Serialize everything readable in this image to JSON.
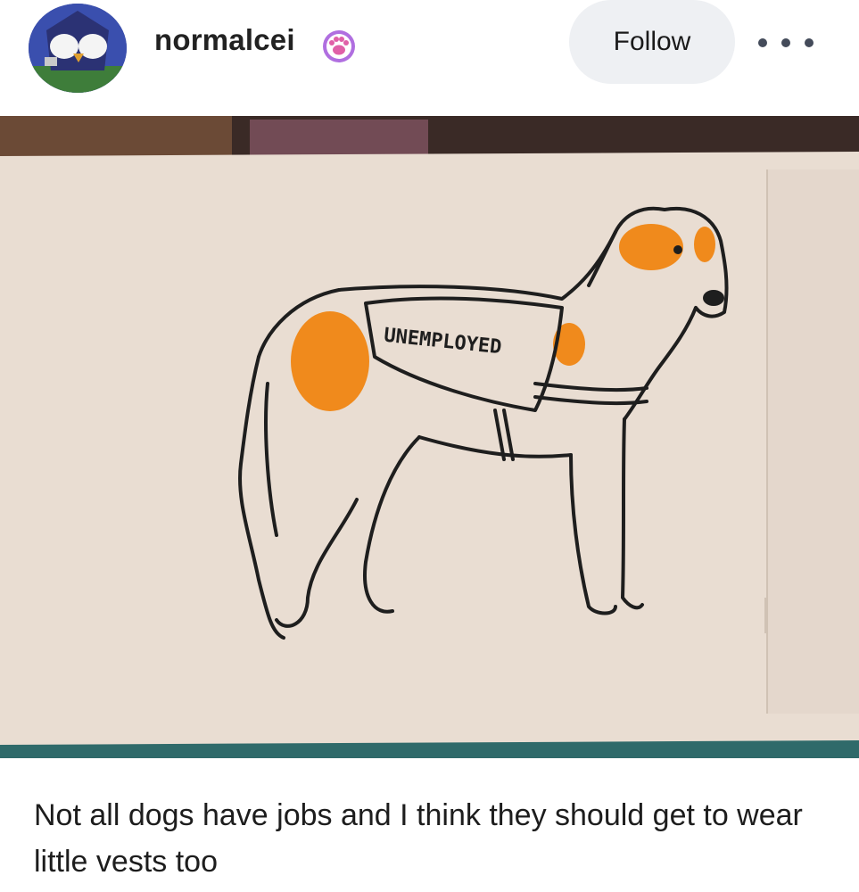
{
  "post": {
    "author": {
      "username": "normalcei",
      "avatar_icon": "avatar-penguin-icon",
      "badge_icon": "paw-badge-icon",
      "badge_color": "#b06fe0"
    },
    "actions": {
      "follow_label": "Follow",
      "more_icon": "ellipsis-icon"
    },
    "image": {
      "drawing_label": "UNEMPLOYED",
      "accent_color": "#f08a1c",
      "paper_color": "#e9ddd2"
    },
    "caption": "Not all dogs have jobs and I think they should get to wear little vests too"
  }
}
